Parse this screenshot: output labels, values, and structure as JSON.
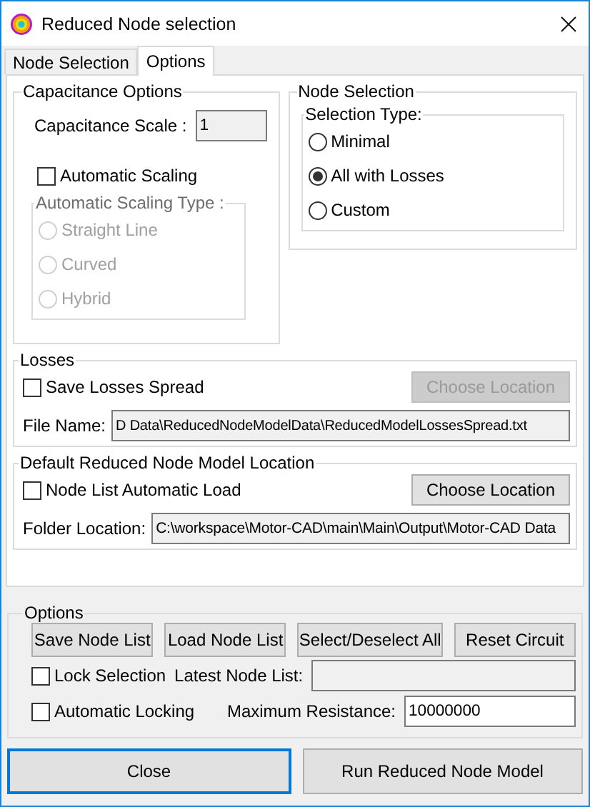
{
  "window": {
    "title": "Reduced Node selection"
  },
  "tabs": [
    {
      "label": "Node Selection",
      "selected": false
    },
    {
      "label": "Options",
      "selected": true
    }
  ],
  "capacitance_options": {
    "legend": "Capacitance Options",
    "scale_label": "Capacitance Scale :",
    "scale_value": "1",
    "automatic_scaling": {
      "label": "Automatic Scaling",
      "checked": false
    },
    "scaling_type": {
      "legend": "Automatic Scaling Type :",
      "disabled": true,
      "options": [
        {
          "label": "Straight Line",
          "selected": false
        },
        {
          "label": "Curved",
          "selected": false
        },
        {
          "label": "Hybrid",
          "selected": false
        }
      ]
    }
  },
  "node_selection": {
    "legend": "Node Selection",
    "selection_type": {
      "legend": "Selection Type:",
      "options": [
        {
          "label": "Minimal",
          "selected": false
        },
        {
          "label": "All with Losses",
          "selected": true
        },
        {
          "label": "Custom",
          "selected": false
        }
      ]
    }
  },
  "losses": {
    "legend": "Losses",
    "save": {
      "label": "Save Losses Spread",
      "checked": false
    },
    "choose_button": {
      "label": "Choose Location",
      "disabled": true
    },
    "file_label": "File Name:",
    "file_value": "D Data\\ReducedNodeModelData\\ReducedModelLossesSpread.txt"
  },
  "default_location": {
    "legend": "Default Reduced Node Model Location",
    "auto_load": {
      "label": "Node List Automatic Load",
      "checked": false
    },
    "choose_button": {
      "label": "Choose Location",
      "disabled": false
    },
    "folder_label": "Folder Location:",
    "folder_value": "C:\\workspace\\Motor-CAD\\main\\Main\\Output\\Motor-CAD Data"
  },
  "options": {
    "legend": "Options",
    "buttons": [
      "Save Node List",
      "Load Node List",
      "Select/Deselect All",
      "Reset Circuit"
    ],
    "lock_selection": {
      "label": "Lock Selection",
      "checked": false
    },
    "latest_label": "Latest Node List:",
    "automatic_locking": {
      "label": "Automatic Locking",
      "checked": false
    },
    "max_label": "Maximum Resistance:",
    "max_value": "10000000"
  },
  "footer_buttons": [
    {
      "label": "Close",
      "focused": true
    },
    {
      "label": "Run Reduced Node Model",
      "focused": false
    }
  ]
}
